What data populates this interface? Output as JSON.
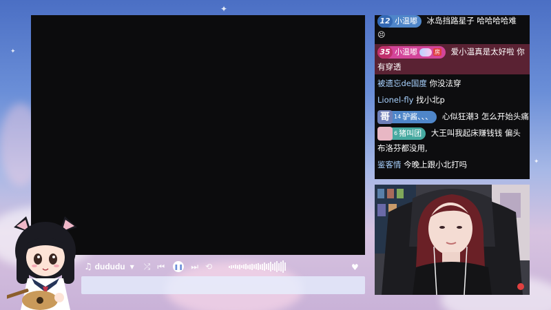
{
  "player": {
    "logo_icon": "cat-music-icon",
    "title": "dududu",
    "controls": [
      "shuffle-icon",
      "previous-icon",
      "pause-icon",
      "next-icon",
      "repeat-icon"
    ]
  },
  "chat": {
    "lines": [
      {
        "badge_level": "12",
        "badge_name": "小温嘟",
        "message": "冰岛挡路星子 哈哈哈哈难"
      },
      {
        "message": "😣"
      },
      {
        "badge_level": "35",
        "badge_name": "小温嘟",
        "badge_tag": "房",
        "message": "爱小温真是太好啦 你"
      },
      {
        "message": "有穿透"
      },
      {
        "user": "被遗忘de国度",
        "message": "你没法穿"
      },
      {
        "user": "Lionel-fly",
        "message": "找小北p"
      },
      {
        "avatar_label": "哥",
        "avatar_num": "14",
        "badge_name": "驴酱、、、",
        "message": "心似狂潮3 怎么开始头痛"
      },
      {
        "avatar_num": "6",
        "badge_name": "猪叫团",
        "message": "大王叫我起床赚钱钱 偏头"
      },
      {
        "message": "布洛芬都没用,"
      },
      {
        "user": "鉴客情",
        "message": "今晚上跟小北打吗"
      }
    ]
  },
  "colors": {
    "chat_bg": "#0d0d0f",
    "username": "#a9d2ff",
    "badge_blue": "#4f86c9",
    "badge_pink": "#d3459a",
    "badge_green": "#46a9a0"
  }
}
